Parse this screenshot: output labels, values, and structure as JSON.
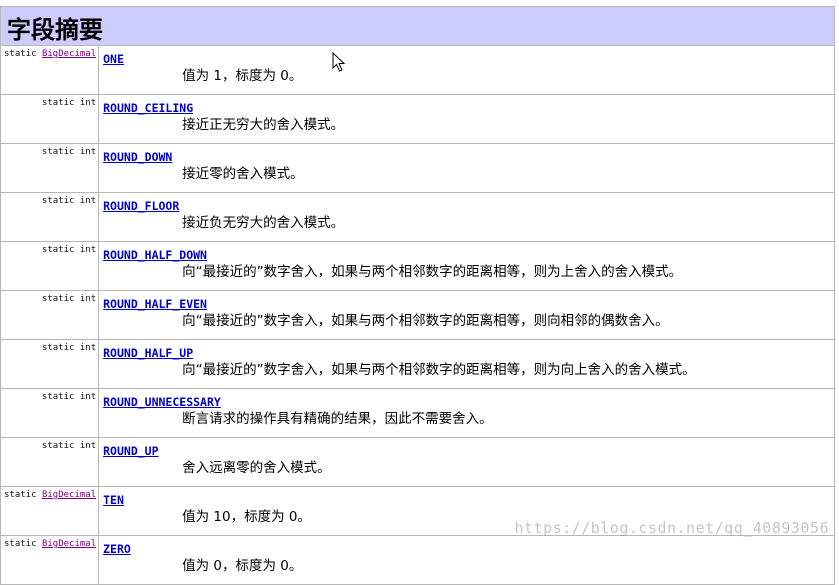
{
  "section_title": "字段摘要",
  "fields": [
    {
      "modifier": "static",
      "type": "BigDecimal",
      "type_is_link": true,
      "name": "ONE",
      "description": "值为 1，标度为 0。"
    },
    {
      "modifier": "static",
      "type": "int",
      "type_is_link": false,
      "name": "ROUND_CEILING",
      "description": "接近正无穷大的舍入模式。"
    },
    {
      "modifier": "static",
      "type": "int",
      "type_is_link": false,
      "name": "ROUND_DOWN",
      "description": "接近零的舍入模式。"
    },
    {
      "modifier": "static",
      "type": "int",
      "type_is_link": false,
      "name": "ROUND_FLOOR",
      "description": "接近负无穷大的舍入模式。"
    },
    {
      "modifier": "static",
      "type": "int",
      "type_is_link": false,
      "name": "ROUND_HALF_DOWN",
      "description": "向“最接近的”数字舍入，如果与两个相邻数字的距离相等，则为上舍入的舍入模式。"
    },
    {
      "modifier": "static",
      "type": "int",
      "type_is_link": false,
      "name": "ROUND_HALF_EVEN",
      "description": "向“最接近的”数字舍入，如果与两个相邻数字的距离相等，则向相邻的偶数舍入。"
    },
    {
      "modifier": "static",
      "type": "int",
      "type_is_link": false,
      "name": "ROUND_HALF_UP",
      "description": "向“最接近的”数字舍入，如果与两个相邻数字的距离相等，则为向上舍入的舍入模式。"
    },
    {
      "modifier": "static",
      "type": "int",
      "type_is_link": false,
      "name": "ROUND_UNNECESSARY",
      "description": "断言请求的操作具有精确的结果，因此不需要舍入。"
    },
    {
      "modifier": "static",
      "type": "int",
      "type_is_link": false,
      "name": "ROUND_UP",
      "description": "舍入远离零的舍入模式。"
    },
    {
      "modifier": "static",
      "type": "BigDecimal",
      "type_is_link": true,
      "name": "TEN",
      "description": "值为 10，标度为 0。"
    },
    {
      "modifier": "static",
      "type": "BigDecimal",
      "type_is_link": true,
      "name": "ZERO",
      "description": "值为 0，标度为 0。"
    }
  ],
  "watermark": "https://blog.csdn.net/qq_40893056",
  "icons": {
    "cursor": "mouse-pointer-icon"
  }
}
